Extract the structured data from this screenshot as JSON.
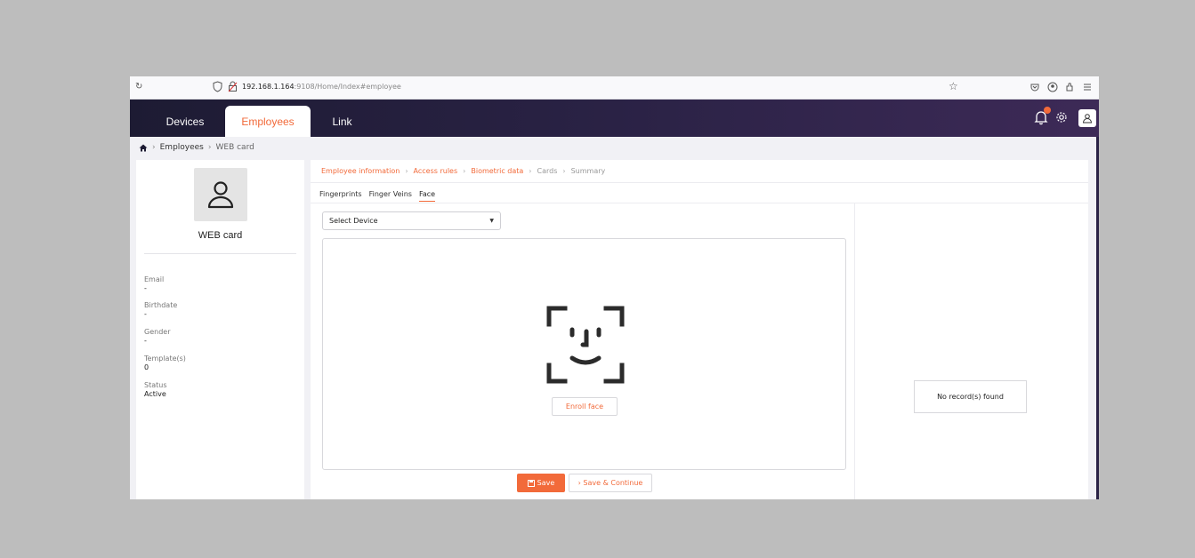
{
  "browser": {
    "url_host": "192.168.1.164",
    "url_rest": ":9108/Home/Index#employee"
  },
  "nav": {
    "tabs": [
      {
        "label": "Devices"
      },
      {
        "label": "Employees"
      },
      {
        "label": "Link"
      }
    ],
    "accent": "#f26a3a"
  },
  "breadcrumb": {
    "items": [
      "Employees",
      "WEB card"
    ]
  },
  "employee": {
    "name": "WEB card",
    "fields": [
      {
        "label": "Email",
        "value": "-"
      },
      {
        "label": "Birthdate",
        "value": "-"
      },
      {
        "label": "Gender",
        "value": "-"
      },
      {
        "label": "Template(s)",
        "value": "0"
      },
      {
        "label": "Status",
        "value": "Active"
      }
    ]
  },
  "steps": [
    {
      "label": "Employee information"
    },
    {
      "label": "Access rules"
    },
    {
      "label": "Biometric data"
    },
    {
      "label": "Cards"
    },
    {
      "label": "Summary"
    }
  ],
  "subtabs": [
    "Fingerprints",
    "Finger Veins",
    "Face"
  ],
  "device_select": {
    "value": "Select Device"
  },
  "enroll_label": "Enroll face",
  "save_label": "Save",
  "save_continue_label": "› Save & Continue",
  "records_empty": "No record(s) found"
}
